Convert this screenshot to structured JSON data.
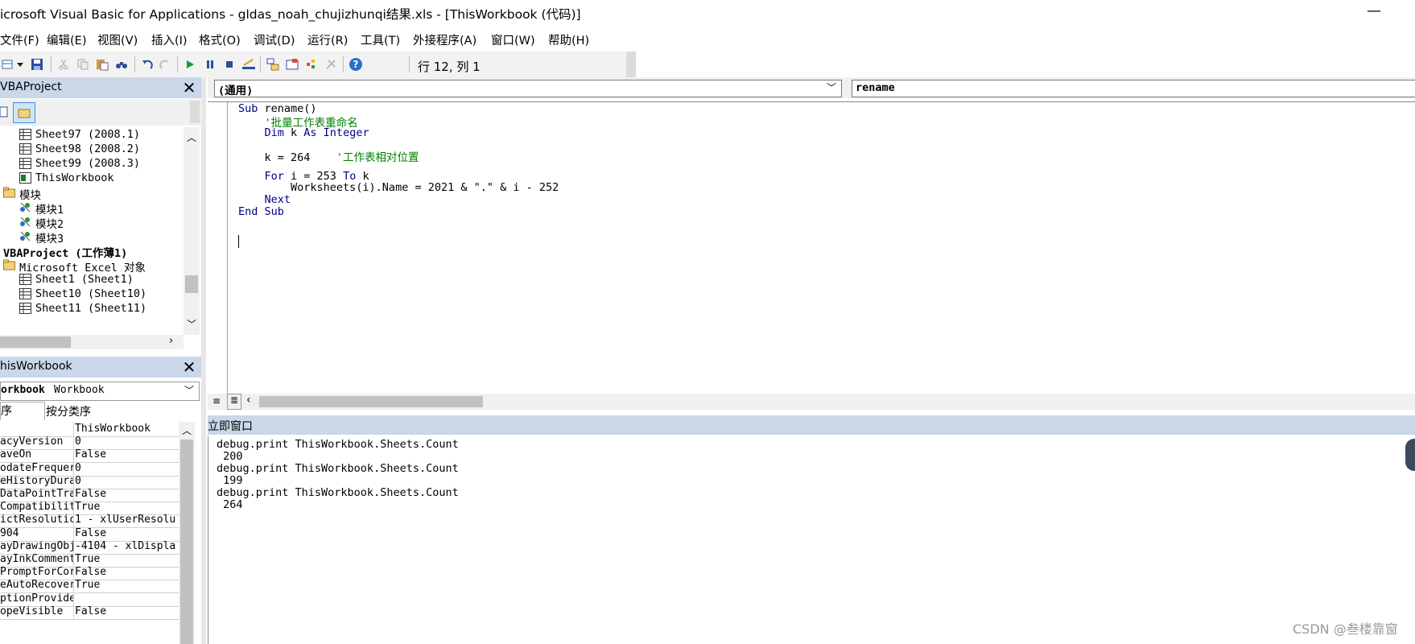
{
  "window": {
    "title": "icrosoft Visual Basic for Applications - gldas_noah_chujizhunqi结果.xls - [ThisWorkbook (代码)]",
    "minimize_glyph": "—"
  },
  "menu": {
    "items": [
      {
        "label": "文件(F)"
      },
      {
        "label": "编辑(E)"
      },
      {
        "label": "视图(V)"
      },
      {
        "label": "插入(I)"
      },
      {
        "label": "格式(O)"
      },
      {
        "label": "调试(D)"
      },
      {
        "label": "运行(R)"
      },
      {
        "label": "工具(T)"
      },
      {
        "label": "外接程序(A)"
      },
      {
        "label": "窗口(W)"
      },
      {
        "label": "帮助(H)"
      }
    ]
  },
  "toolbar": {
    "position_text": "行 12, 列 1",
    "icons": [
      "excel-view-icon",
      "dropdown-icon",
      "save-icon",
      "cut-icon",
      "copy-icon",
      "paste-icon",
      "find-icon",
      "undo-icon",
      "redo-icon",
      "run-icon",
      "break-icon",
      "reset-icon",
      "design-mode-icon",
      "project-explorer-icon",
      "properties-icon",
      "object-browser-icon",
      "toolbox-icon",
      "help-icon"
    ]
  },
  "project_pane": {
    "title": "VBAProject",
    "tree": [
      {
        "label": "Sheet97 (2008.1)",
        "type": "sheet"
      },
      {
        "label": "Sheet98 (2008.2)",
        "type": "sheet"
      },
      {
        "label": "Sheet99 (2008.3)",
        "type": "sheet"
      },
      {
        "label": "ThisWorkbook",
        "type": "workbook"
      },
      {
        "label": "模块",
        "type": "folder"
      },
      {
        "label": "模块1",
        "type": "module"
      },
      {
        "label": "模块2",
        "type": "module"
      },
      {
        "label": "模块3",
        "type": "module"
      },
      {
        "label": "VBAProject (工作薄1)",
        "type": "project"
      },
      {
        "label": "Microsoft Excel 对象",
        "type": "folder"
      },
      {
        "label": "Sheet1 (Sheet1)",
        "type": "sheet"
      },
      {
        "label": "Sheet10 (Sheet10)",
        "type": "sheet"
      },
      {
        "label": "Sheet11 (Sheet11)",
        "type": "sheet"
      }
    ]
  },
  "properties_pane": {
    "title": "hisWorkbook",
    "object_name": "orkbook",
    "object_type": "Workbook",
    "tabs": [
      "序",
      "按分类序"
    ],
    "rows": [
      {
        "key": "",
        "value": "ThisWorkbook"
      },
      {
        "key": "acyVersion",
        "value": "0"
      },
      {
        "key": "aveOn",
        "value": "False"
      },
      {
        "key": "odateFrequer",
        "value": "0"
      },
      {
        "key": "eHistoryDura",
        "value": "0"
      },
      {
        "key": "DataPointTra",
        "value": "False"
      },
      {
        "key": "Compatibilit",
        "value": "True"
      },
      {
        "key": "ictResolutic",
        "value": "1 - xlUserResolu"
      },
      {
        "key": "904",
        "value": "False"
      },
      {
        "key": "ayDrawingObj",
        "value": "-4104 - xlDispla"
      },
      {
        "key": "ayInkComment",
        "value": "True"
      },
      {
        "key": "PromptForCor",
        "value": "False"
      },
      {
        "key": "eAutoRecover",
        "value": "True"
      },
      {
        "key": "ptionProvide",
        "value": ""
      },
      {
        "key": "opeVisible",
        "value": "False"
      }
    ]
  },
  "code_window": {
    "object_combo": "(通用)",
    "procedure_combo": "rename",
    "lines": [
      {
        "kw": "Sub",
        "rest": " rename()"
      },
      {
        "comment": "    '批量工作表重命名"
      },
      {
        "kw": "    Dim",
        "rest": " k ",
        "kw2": "As Integer"
      },
      {
        "text": "    k = 264    ",
        "comment": "'工作表相对位置"
      },
      {
        "kw": "    For",
        "rest": " i = 253 ",
        "kw2": "To",
        "rest2": " k"
      },
      {
        "text": "        Worksheets(i).Name = 2021 & \".\" & i - 252"
      },
      {
        "kw": "    Next"
      },
      {
        "kw": "End Sub"
      }
    ]
  },
  "immediate_window": {
    "title": "立即窗口",
    "lines": [
      "debug.print ThisWorkbook.Sheets.Count",
      " 200",
      "debug.print ThisWorkbook.Sheets.Count",
      " 199",
      "debug.print ThisWorkbook.Sheets.Count",
      " 264"
    ]
  },
  "watermark": "CSDN @叁楼靠窗"
}
